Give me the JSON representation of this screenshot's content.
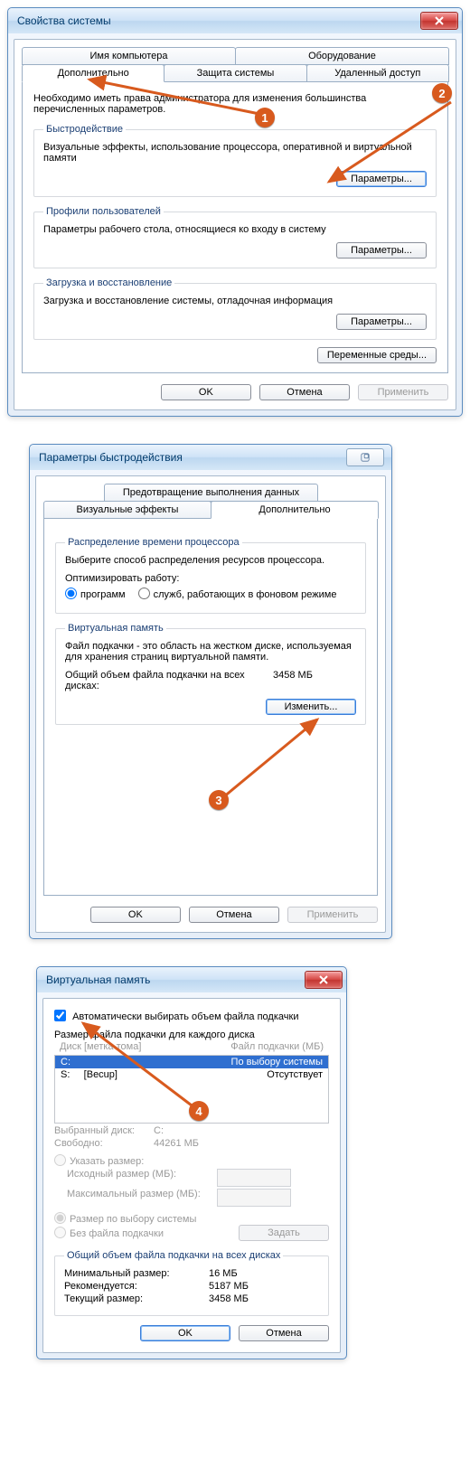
{
  "w1": {
    "title": "Свойства системы",
    "tabs_row1": [
      "Имя компьютера",
      "Оборудование"
    ],
    "tabs_row2": [
      "Дополнительно",
      "Защита системы",
      "Удаленный доступ"
    ],
    "intro": "Необходимо иметь права администратора для изменения большинства перечисленных параметров.",
    "grp_perf_title": "Быстродействие",
    "grp_perf_desc": "Визуальные эффекты, использование процессора, оперативной и виртуальной памяти",
    "grp_perf_btn": "Параметры...",
    "grp_prof_title": "Профили пользователей",
    "grp_prof_desc": "Параметры рабочего стола, относящиеся ко входу в систему",
    "grp_prof_btn": "Параметры...",
    "grp_boot_title": "Загрузка и восстановление",
    "grp_boot_desc": "Загрузка и восстановление системы, отладочная информация",
    "grp_boot_btn": "Параметры...",
    "env_btn": "Переменные среды...",
    "ok": "OK",
    "cancel": "Отмена",
    "apply": "Применить"
  },
  "w2": {
    "title": "Параметры быстродействия",
    "tab_top": "Предотвращение выполнения данных",
    "tab_left": "Визуальные эффекты",
    "tab_right": "Дополнительно",
    "cpu_title": "Распределение времени процессора",
    "cpu_desc": "Выберите способ распределения ресурсов процессора.",
    "opt_label": "Оптимизировать работу:",
    "opt_prog": "программ",
    "opt_bg": "служб, работающих в фоновом режиме",
    "vm_title": "Виртуальная память",
    "vm_desc": "Файл подкачки - это область на жестком диске, используемая для хранения страниц виртуальной памяти.",
    "vm_total_l": "Общий объем файла подкачки на всех дисках:",
    "vm_total_v": "3458 МБ",
    "vm_btn": "Изменить...",
    "ok": "OK",
    "cancel": "Отмена",
    "apply": "Применить"
  },
  "w3": {
    "title": "Виртуальная память",
    "auto_chk": "Автоматически выбирать объем файла подкачки",
    "heading": "Размер файла подкачки для каждого диска",
    "col_disk": "Диск [метка тома]",
    "col_page": "Файл подкачки (МБ)",
    "row1_d": "C:",
    "row1_p": "По выбору системы",
    "row2_d": "S:     [Becup]",
    "row2_p": "Отсутствует",
    "sel_drive_l": "Выбранный диск:",
    "sel_drive_v": "C:",
    "free_l": "Свободно:",
    "free_v": "44261 МБ",
    "r_custom": "Указать размер:",
    "init_l": "Исходный размер (МБ):",
    "max_l": "Максимальный размер (МБ):",
    "r_sys": "Размер по выбору системы",
    "r_none": "Без файла подкачки",
    "set_btn": "Задать",
    "sum_title": "Общий объем файла подкачки на всех дисках",
    "min_l": "Минимальный размер:",
    "min_v": "16 МБ",
    "rec_l": "Рекомендуется:",
    "rec_v": "5187 МБ",
    "cur_l": "Текущий размер:",
    "cur_v": "3458 МБ",
    "ok": "OK",
    "cancel": "Отмена"
  },
  "markers": {
    "m1": "1",
    "m2": "2",
    "m3": "3",
    "m4": "4"
  }
}
